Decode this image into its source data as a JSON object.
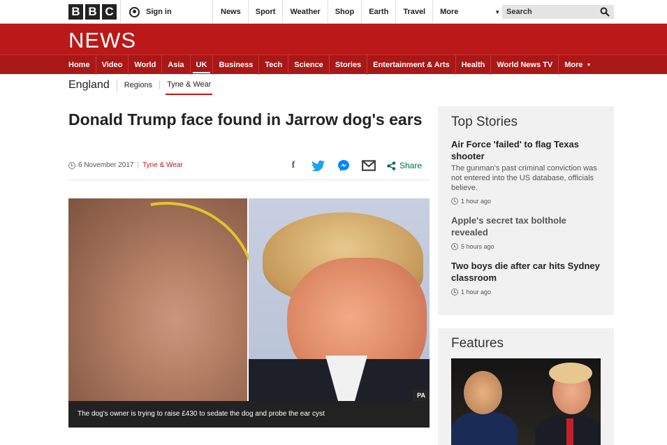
{
  "topbar": {
    "logo_letters": [
      "B",
      "B",
      "C"
    ],
    "signin_label": "Sign in",
    "nav": [
      "News",
      "Sport",
      "Weather",
      "Shop",
      "Earth",
      "Travel"
    ],
    "more_label": "More",
    "search_label": "Search"
  },
  "news_banner": {
    "title": "NEWS"
  },
  "section_nav": {
    "items": [
      "Home",
      "Video",
      "World",
      "Asia",
      "UK",
      "Business",
      "Tech",
      "Science",
      "Stories",
      "Entertainment & Arts",
      "Health",
      "World News TV",
      "More"
    ],
    "active": "UK"
  },
  "sub_nav": {
    "region": "England",
    "regions_link": "Regions",
    "current": "Tyne & Wear"
  },
  "article": {
    "headline": "Donald Trump face found in Jarrow dog's ears",
    "date": "6 November 2017",
    "category": "Tyne & Wear",
    "share_label": "Share",
    "image_credit": "PA",
    "caption": "The dog's owner is trying to raise £430 to sedate the dog and probe the ear cyst"
  },
  "colors": {
    "brand_red": "#bb1919",
    "share_green": "#006853",
    "facebook": "#3b5998",
    "twitter": "#1da1f2",
    "messenger": "#0084ff"
  },
  "sidebar": {
    "top_stories_title": "Top Stories",
    "stories": [
      {
        "title": "Air Force 'failed' to flag Texas shooter",
        "summary": "The gunman's past criminal conviction was not entered into the US database, officials believe.",
        "time": "1 hour ago"
      },
      {
        "title": "Apple's secret tax bolthole revealed",
        "summary": "",
        "time": "5 hours ago"
      },
      {
        "title": "Two boys die after car hits Sydney classroom",
        "summary": "",
        "time": "1 hour ago"
      }
    ],
    "features_title": "Features"
  }
}
